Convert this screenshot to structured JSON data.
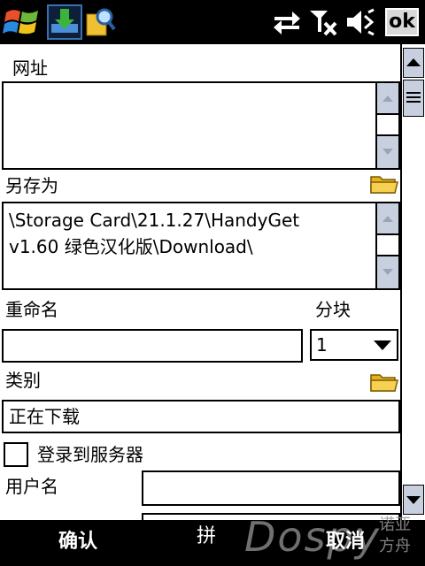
{
  "status_bar": {
    "ok_label": "ok",
    "icons": [
      "windows-start-icon",
      "download-app-icon",
      "search-folder-icon",
      "sync-icon",
      "no-signal-icon",
      "volume-icon"
    ]
  },
  "form": {
    "url_label": "网址",
    "url_value": "",
    "save_as_label": "另存为",
    "save_as_lines": [
      "\\Storage Card\\21.1.27\\HandyGet",
      "v1.60 绿色汉化版\\Download\\"
    ],
    "rename_label": "重命名",
    "rename_value": "",
    "split_label": "分块",
    "split_value": "1",
    "category_label": "类别",
    "category_value": "正在下载",
    "login_label": "登录到服务器",
    "login_checked": false,
    "username_label": "用户名",
    "username_value": ""
  },
  "bottom_bar": {
    "left_softkey": "确认",
    "ime_label": "拼",
    "right_softkey": "取消",
    "watermark": "Dospy",
    "watermark_sub1": "诺亚",
    "watermark_sub2": "方舟"
  },
  "colors": {
    "bar_bg": "#000000",
    "scroll_button": "#c8d0e0",
    "folder": "#f0c030"
  }
}
